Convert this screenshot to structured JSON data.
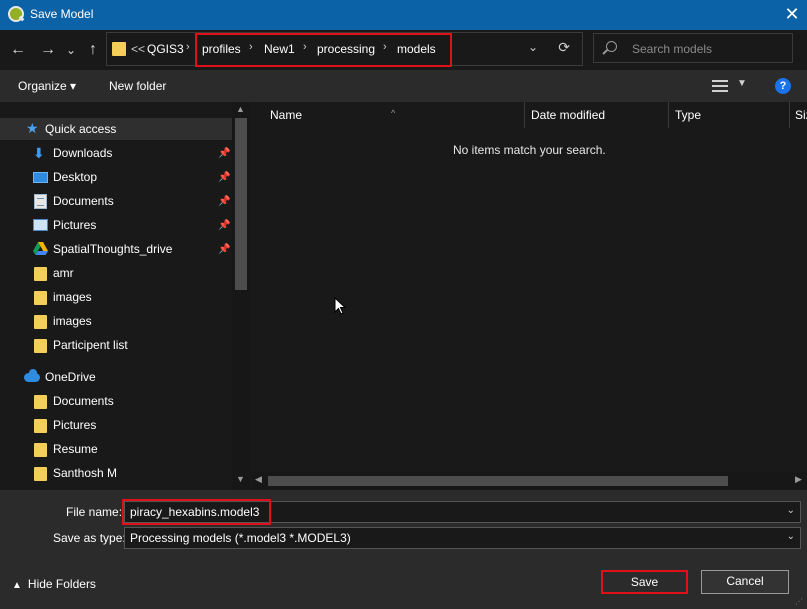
{
  "window": {
    "title": "Save Model",
    "close_label": "✕"
  },
  "navbar": {
    "back": "←",
    "forward": "→",
    "recent": "⌄",
    "up": "↑",
    "overflow": "<<",
    "breadcrumbs": [
      "QGIS3",
      "profiles",
      "New1",
      "processing",
      "models"
    ],
    "separator": "›",
    "refresh": "⟳"
  },
  "search": {
    "placeholder": "Search models"
  },
  "toolbar": {
    "organize": "Organize ▾",
    "new_folder": "New folder",
    "help": "?"
  },
  "sidebar": {
    "quick_access": "Quick access",
    "items": [
      {
        "label": "Downloads",
        "icon": "download-icon",
        "pinned": true
      },
      {
        "label": "Desktop",
        "icon": "desktop-icon",
        "pinned": true
      },
      {
        "label": "Documents",
        "icon": "documents-icon",
        "pinned": true
      },
      {
        "label": "Pictures",
        "icon": "pictures-icon",
        "pinned": true
      },
      {
        "label": "SpatialThoughts_drive",
        "icon": "google-drive-icon",
        "pinned": true
      },
      {
        "label": "amr",
        "icon": "folder-icon",
        "pinned": false
      },
      {
        "label": "images",
        "icon": "folder-icon",
        "pinned": false
      },
      {
        "label": "images",
        "icon": "folder-icon",
        "pinned": false
      },
      {
        "label": "Participent list",
        "icon": "folder-icon",
        "pinned": false
      }
    ],
    "onedrive": "OneDrive",
    "onedrive_items": [
      "Documents",
      "Pictures",
      "Resume",
      "Santhosh M"
    ]
  },
  "content": {
    "columns": [
      "Name",
      "Date modified",
      "Type",
      "Size"
    ],
    "empty_message": "No items match your search."
  },
  "form": {
    "file_name_label": "File name:",
    "file_name_value": "piracy_hexabins.model3",
    "save_type_label": "Save as type:",
    "save_type_value": "Processing models (*.model3 *.MODEL3)"
  },
  "footer": {
    "hide_folders": "Hide Folders",
    "save": "Save",
    "cancel": "Cancel"
  },
  "colors": {
    "titlebar": "#0b62a6",
    "highlight": "#e0101a",
    "folder": "#f4cf57",
    "accent": "#2f8be0"
  }
}
